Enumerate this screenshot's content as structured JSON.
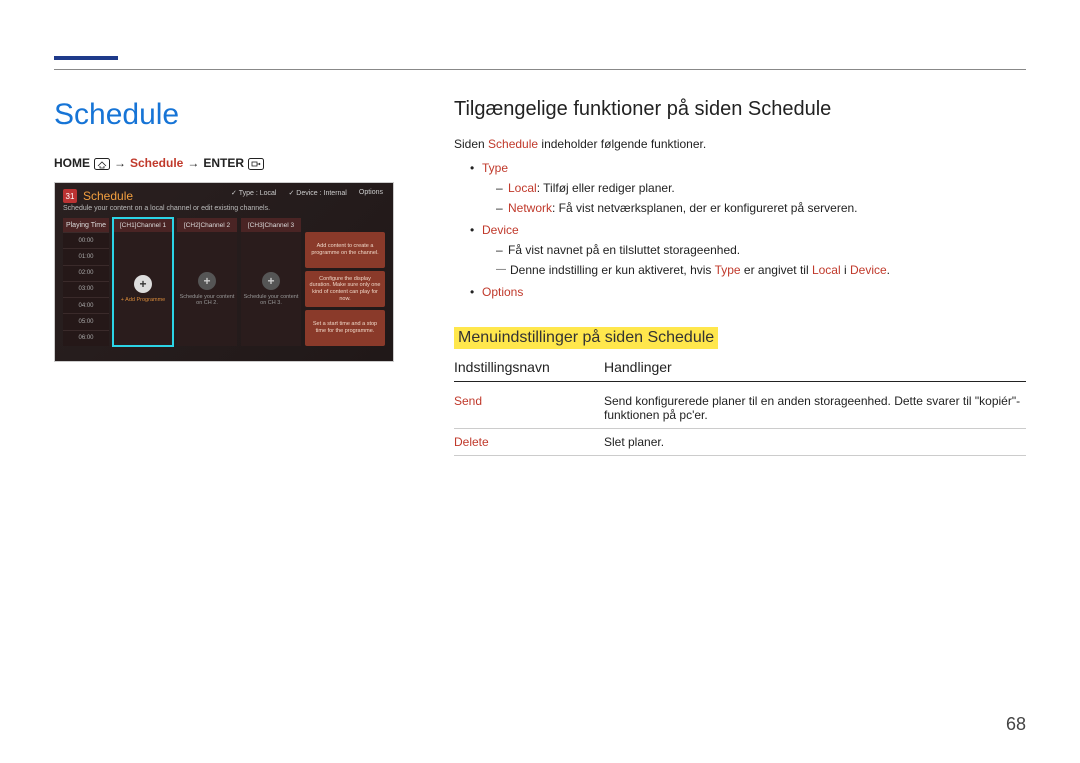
{
  "page_number": "68",
  "left": {
    "title": "Schedule",
    "breadcrumb": {
      "part1": "HOME",
      "part2": "Schedule",
      "part3": "ENTER",
      "arrow": "→"
    },
    "screenshot": {
      "title": "Schedule",
      "subtitle": "Schedule your content on a local channel or edit existing channels.",
      "calendar_day": "31",
      "playing_time_label": "Playing Time",
      "top_right": {
        "type_label": "Type : Local",
        "device_label": "Device : Internal",
        "options_label": "Options"
      },
      "times": [
        "00:00",
        "01:00",
        "02:00",
        "03:00",
        "04:00",
        "05:00",
        "06:00"
      ],
      "channels": [
        {
          "name": "[CH1]Channel 1",
          "label": "+ Add Programme",
          "selected": true
        },
        {
          "name": "[CH2]Channel 2",
          "label": "Schedule your content on CH 2.",
          "selected": false
        },
        {
          "name": "[CH3]Channel 3",
          "label": "Schedule your content on CH 3.",
          "selected": false
        }
      ],
      "cards": [
        "Add content to create a programme on the channel.",
        "Configure the display duration. Make sure only one kind of content can play for now.",
        "Set a start time and a stop time for the programme."
      ]
    }
  },
  "right": {
    "h2": "Tilgængelige funktioner på siden Schedule",
    "intro_prefix": "Siden ",
    "intro_highlight": "Schedule",
    "intro_suffix": " indeholder følgende funktioner.",
    "type": {
      "label": "Type",
      "local_label": "Local",
      "local_text": ": Tilføj eller rediger planer.",
      "network_label": "Network",
      "network_text": ": Få vist netværksplanen, der er konfigureret på serveren."
    },
    "device": {
      "label": "Device",
      "line1": "Få vist navnet på en tilsluttet storageenhed.",
      "note_prefix": "Denne indstilling er kun aktiveret, hvis ",
      "note_mid": " er angivet til ",
      "note_in": " i ",
      "note_end": ".",
      "note_type": "Type",
      "note_local": "Local",
      "note_device": "Device"
    },
    "options_label": "Options",
    "h3": "Menuindstillinger på siden Schedule",
    "table": {
      "col1": "Indstillingsnavn",
      "col2": "Handlinger",
      "rows": [
        {
          "name": "Send",
          "action": "Send konfigurerede planer til en anden storageenhed. Dette svarer til \"kopiér\"-funktionen på pc'er."
        },
        {
          "name": "Delete",
          "action": "Slet planer."
        }
      ]
    }
  }
}
